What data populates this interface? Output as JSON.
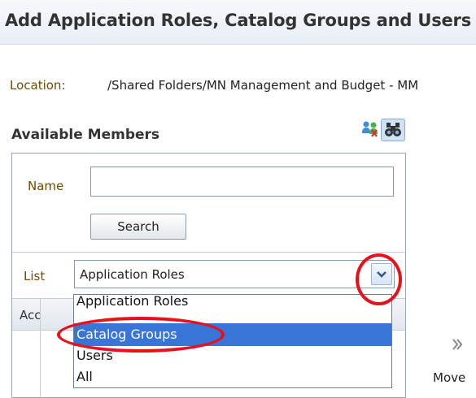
{
  "dialog": {
    "title": "Add Application Roles, Catalog Groups and Users"
  },
  "location": {
    "label": "Location:",
    "value": "/Shared Folders/MN Management and Budget - MM"
  },
  "available_members": {
    "title": "Available Members",
    "icons": [
      "roles-users-icon",
      "binoculars-search-icon"
    ],
    "name_field": {
      "label": "Name",
      "value": "",
      "placeholder": ""
    },
    "search_label": "Search",
    "list": {
      "label": "List",
      "selected": "Application Roles",
      "options": [
        "Application Roles",
        "Catalog Groups",
        "Users",
        "All"
      ],
      "highlighted": "Catalog Groups"
    },
    "table": {
      "header_partial": "Acc"
    }
  },
  "move": {
    "label": "Move",
    "icon": "double-chevron-right-icon"
  },
  "annotations": {
    "highlight_color": "#e8101a",
    "selection_color": "#3875d7"
  }
}
